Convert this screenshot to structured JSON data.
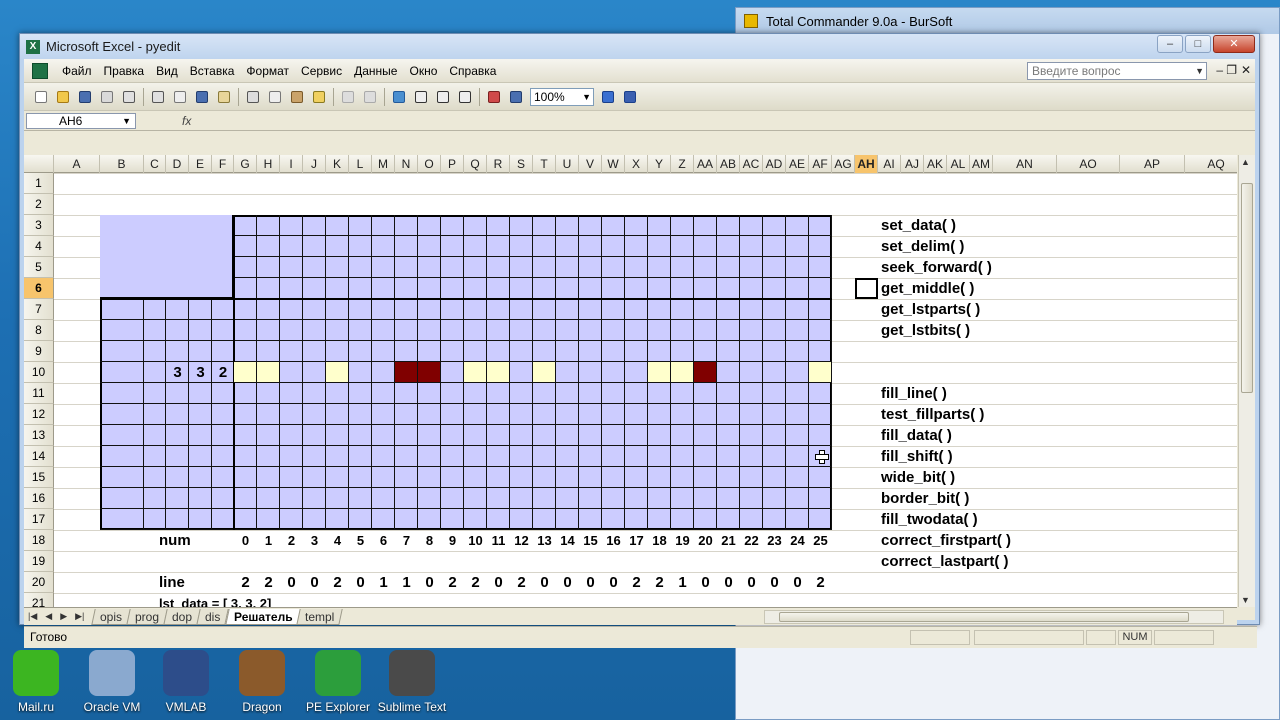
{
  "desktop": {
    "bottom_icons": [
      {
        "label": "Mail.ru",
        "icon": "mail-icon",
        "color": "#3cb521"
      },
      {
        "label": "Oracle VM",
        "icon": "virtualbox-icon",
        "color": "#8aa9cf"
      },
      {
        "label": "VMLAB",
        "icon": "chip-icon",
        "color": "#2d4d8a"
      },
      {
        "label": "Dragon",
        "icon": "chest-icon",
        "color": "#8b5a2b"
      },
      {
        "label": "PE Explorer",
        "icon": "pe-icon",
        "color": "#2c9e3c"
      },
      {
        "label": "Sublime Text",
        "icon": "sublime-icon",
        "color": "#4a4a4a"
      }
    ]
  },
  "background_window": {
    "title": "Total Commander 9.0a - BurSoft"
  },
  "excel": {
    "title": "Microsoft Excel - pyedit",
    "menu": [
      "Файл",
      "Правка",
      "Вид",
      "Вставка",
      "Формат",
      "Сервис",
      "Данные",
      "Окно",
      "Справка"
    ],
    "ask_placeholder": "Введите вопрос",
    "zoom": "100%",
    "name_box": "AH6",
    "fx_label": "fx",
    "status": "Готово",
    "num_indicator": "NUM",
    "sheet_tabs": [
      "opis",
      "prog",
      "dop",
      "dis",
      "Решатель",
      "templ"
    ],
    "active_tab": "Решатель",
    "columns": [
      "A",
      "B",
      "C",
      "D",
      "E",
      "F",
      "G",
      "H",
      "I",
      "J",
      "K",
      "L",
      "M",
      "N",
      "O",
      "P",
      "Q",
      "R",
      "S",
      "T",
      "U",
      "V",
      "W",
      "X",
      "Y",
      "Z",
      "AA",
      "AB",
      "AC",
      "AD",
      "AE",
      "AF",
      "AG",
      "AH",
      "AI",
      "AJ",
      "AK",
      "AL",
      "AM",
      "AN",
      "AO",
      "AP",
      "AQ"
    ],
    "selected_column": "AH",
    "rows": [
      "1",
      "2",
      "3",
      "4",
      "5",
      "6",
      "7",
      "8",
      "9",
      "10",
      "11",
      "12",
      "13",
      "14",
      "15",
      "16",
      "17",
      "18",
      "19",
      "20",
      "21"
    ],
    "selected_row": "6",
    "row10_clues": [
      "3",
      "3",
      "2"
    ],
    "row10_states": [
      "y",
      "y",
      "",
      "",
      "y",
      "",
      "",
      "d",
      "d",
      "",
      "y",
      "y",
      "",
      "y",
      "",
      "",
      "",
      "",
      "y",
      "y",
      "d",
      "",
      "",
      "",
      "",
      "y"
    ],
    "num_label": "num",
    "num_values": [
      "0",
      "1",
      "2",
      "3",
      "4",
      "5",
      "6",
      "7",
      "8",
      "9",
      "10",
      "11",
      "12",
      "13",
      "14",
      "15",
      "16",
      "17",
      "18",
      "19",
      "20",
      "21",
      "22",
      "23",
      "24",
      "25"
    ],
    "line_label": "line",
    "line_values": [
      "2",
      "2",
      "0",
      "0",
      "2",
      "0",
      "1",
      "1",
      "0",
      "2",
      "2",
      "0",
      "2",
      "0",
      "0",
      "0",
      "0",
      "2",
      "2",
      "1",
      "0",
      "0",
      "0",
      "0",
      "0",
      "2"
    ],
    "row21_text": "lst_data = [ 3, 3, 2]",
    "functions_top": [
      "set_data( )",
      "set_delim( )",
      "seek_forward( )",
      "get_middle( )",
      "get_lstparts( )",
      "get_lstbits( )"
    ],
    "functions_bottom": [
      "fill_line( )",
      "test_fillparts( )",
      "fill_data( )",
      "fill_shift( )",
      "wide_bit( )",
      "border_bit( )",
      "fill_twodata( )",
      "correct_firstpart( )",
      "correct_lastpart( )"
    ],
    "colors": {
      "grid_fill": "#ccccff",
      "yellow": "#ffffcc",
      "dark": "#800000",
      "selected_header": "#f7c46c"
    }
  }
}
